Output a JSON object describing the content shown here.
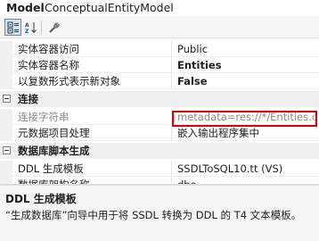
{
  "header": {
    "object_kind": "Model",
    "object_name": "ConceptualEntityModel"
  },
  "toolbar": {
    "buttons": [
      {
        "icon": "categorized-icon",
        "pressed": true
      },
      {
        "icon": "alphabetical-icon",
        "pressed": false
      },
      {
        "icon": "property-pages-icon",
        "pressed": false
      }
    ]
  },
  "properties": {
    "rows": [
      {
        "name": "实体容器访问",
        "value": "Public"
      },
      {
        "name": "实体容器名称",
        "value": "Entities"
      },
      {
        "name": "以复数形式表示新对象",
        "value": "False"
      }
    ],
    "connection_category": "连接",
    "connection_rows": [
      {
        "name": "连接字符串",
        "value": "metadata=res://*/Entities.c"
      },
      {
        "name": "元数据项目处理",
        "value": "嵌入输出程序集中"
      }
    ],
    "db_script_category": "数据库脚本生成",
    "db_script_rows": [
      {
        "name": "DDL 生成模板",
        "value": "SSDLToSQL10.tt (VS)"
      },
      {
        "name": "数据库架构名称",
        "value": "dbo"
      }
    ]
  },
  "description": {
    "title": "DDL 生成模板",
    "body": "“生成数据库”向导中用于将 SSDL 转换为 DDL 的 T4 文本模板。"
  }
}
